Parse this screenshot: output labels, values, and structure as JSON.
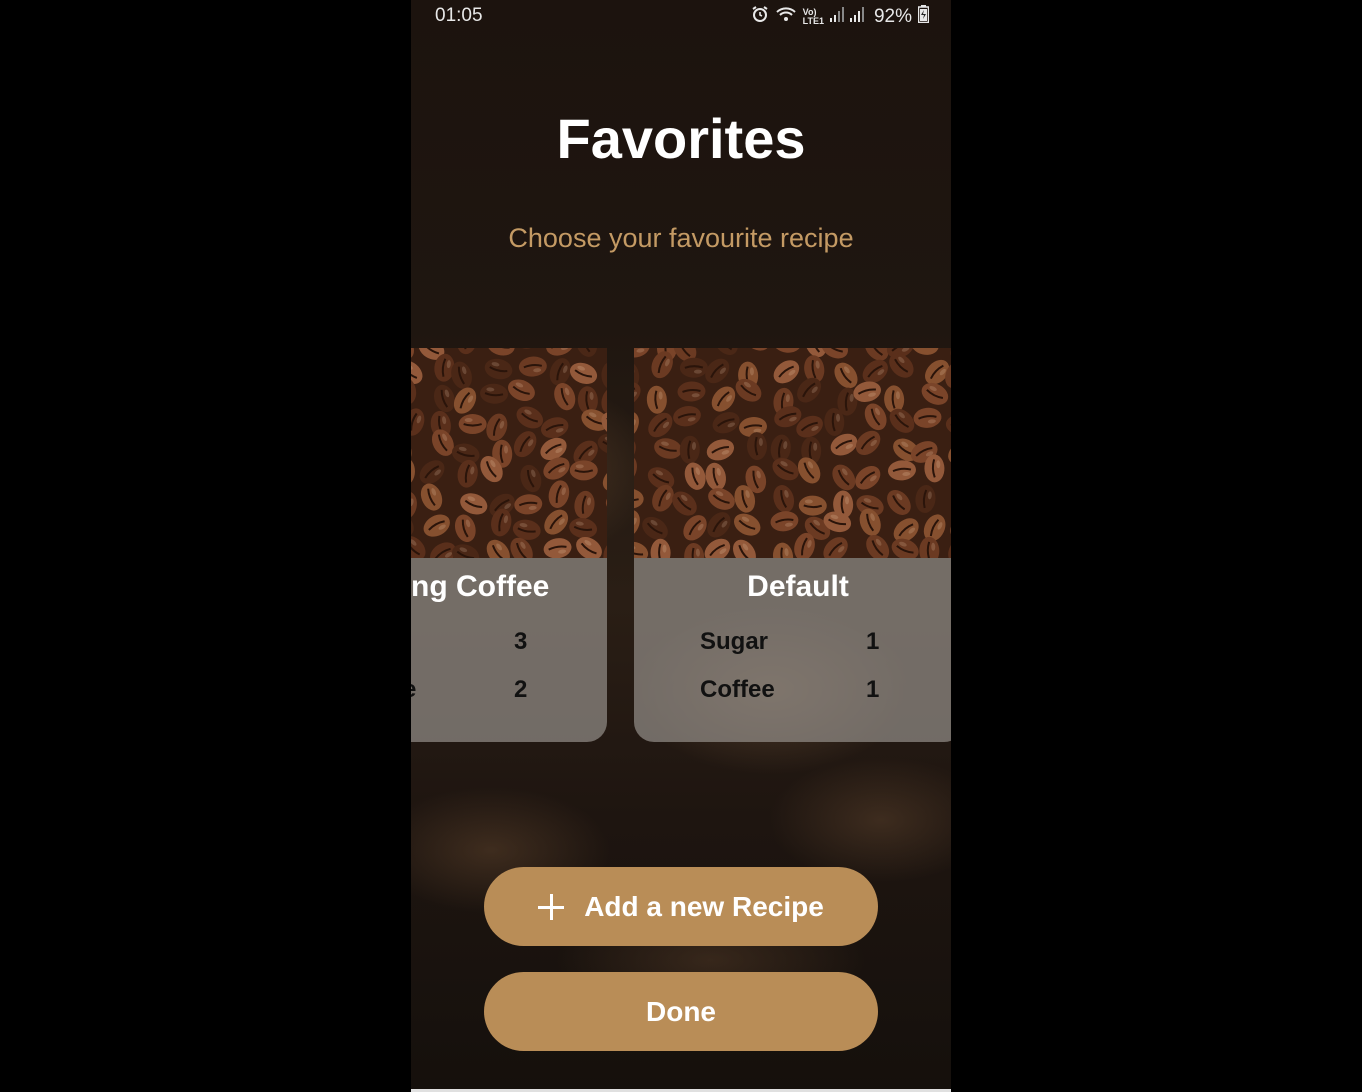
{
  "status_bar": {
    "time": "01:05",
    "battery": "92%",
    "icons": [
      "alarm-icon",
      "wifi-icon",
      "volte-lte-icon",
      "signal-icon",
      "signal-icon",
      "battery-icon"
    ],
    "volte_label": "Vo)",
    "lte_label": "LTE1"
  },
  "header": {
    "title": "Favorites",
    "subtitle": "Choose your favourite recipe"
  },
  "cards": [
    {
      "title": "ng Coffee",
      "rows": [
        {
          "label": "",
          "value": "3"
        },
        {
          "label": "e",
          "value": "2"
        }
      ]
    },
    {
      "title": "Default",
      "rows": [
        {
          "label": "Sugar",
          "value": "1"
        },
        {
          "label": "Coffee",
          "value": "1"
        }
      ]
    }
  ],
  "actions": {
    "add_recipe_label": "Add a new Recipe",
    "add_recipe_icon": "plus-icon",
    "done_label": "Done"
  },
  "colors": {
    "accent": "#b98d57",
    "subtitle": "#c49a64",
    "card_bg": "#918c87"
  }
}
